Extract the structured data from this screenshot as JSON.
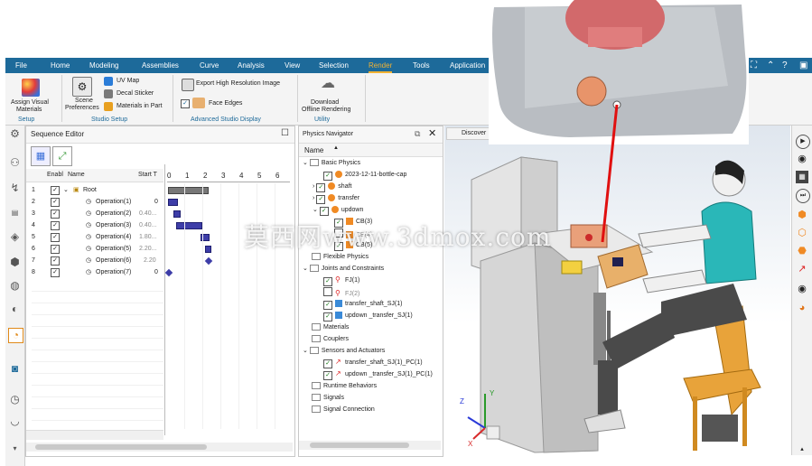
{
  "menubar": {
    "items": [
      "File",
      "Home",
      "Modeling",
      "Assemblies",
      "Curve",
      "Analysis",
      "View",
      "Selection",
      "Render",
      "Tools",
      "Application"
    ],
    "active": "Render"
  },
  "ribbon": {
    "assign_visual": "Assign Visual",
    "materials": "Materials",
    "scene": "Scene",
    "preferences": "Preferences",
    "uv_map": "UV Map",
    "decal_sticker": "Decal Sticker",
    "materials_in_part": "Materials in Part",
    "export_high_res": "Export High Resolution Image",
    "face_edges": "Face Edges",
    "download": "Download",
    "offline_rendering": "Offline Rendering",
    "groups": {
      "setup": "Setup",
      "studio_setup": "Studio Setup",
      "advanced_studio_display": "Advanced Studio Display",
      "utility": "Utility"
    }
  },
  "sequence_editor": {
    "title": "Sequence Editor",
    "columns": {
      "enable": "Enabl",
      "name": "Name",
      "start": "Start T"
    },
    "ruler": [
      "0",
      "1",
      "2",
      "3",
      "4",
      "5",
      "6"
    ],
    "rows": [
      {
        "num": "1",
        "name": "Root",
        "start": ""
      },
      {
        "num": "2",
        "name": "Operation(1)",
        "start": "0"
      },
      {
        "num": "3",
        "name": "Operation(2)",
        "start": "0.40..."
      },
      {
        "num": "4",
        "name": "Operation(3)",
        "start": "0.40..."
      },
      {
        "num": "5",
        "name": "Operation(4)",
        "start": "1.80..."
      },
      {
        "num": "6",
        "name": "Operation(5)",
        "start": "2.20..."
      },
      {
        "num": "7",
        "name": "Operation(6)",
        "start": "2.20"
      },
      {
        "num": "8",
        "name": "Operation(7)",
        "start": "0"
      }
    ]
  },
  "physics_navigator": {
    "title": "Physics Navigator",
    "column": "Name",
    "nodes": {
      "basic_physics": "Basic Physics",
      "bottle_cap": "2023-12-11-bottle-cap",
      "shaft": "shaft",
      "transfer": "transfer",
      "updown": "updown",
      "cb3": "CB(3)",
      "cb4": "CB(4)",
      "cb5": "CB(5)",
      "flexible_physics": "Flexible Physics",
      "joints": "Joints and Constraints",
      "fj1": "FJ(1)",
      "fj2": "FJ(2)",
      "transfer_shaft_sj": "transfer_shaft_SJ(1)",
      "updown_transfer_sj": "updown _transfer_SJ(1)",
      "materials": "Materials",
      "couplers": "Couplers",
      "sensors": "Sensors and Actuators",
      "transfer_shaft_pc": "transfer_shaft_SJ(1)_PC(1)",
      "updown_transfer_pc": "updown _transfer_SJ(1)_PC(1)",
      "runtime": "Runtime Behaviors",
      "signals": "Signals",
      "signal_connection": "Signal Connection"
    }
  },
  "viewport": {
    "tab": "Discover",
    "axes": {
      "x": "X",
      "y": "Y",
      "z": "Z"
    }
  },
  "watermark": "莫西网www.3dmox.com",
  "colors": {
    "menubar": "#1d6a9a",
    "active_tab": "#f2b233",
    "accent_red": "#e01010"
  }
}
